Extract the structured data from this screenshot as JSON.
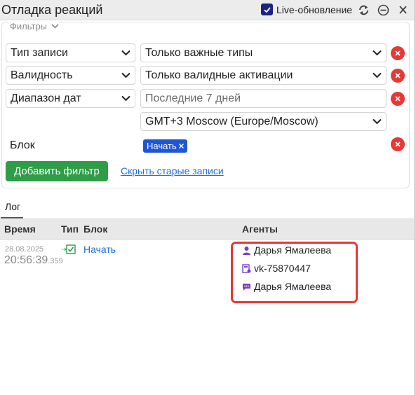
{
  "window": {
    "title": "Отладка реакций"
  },
  "toolbar": {
    "live_label": "Live-обновление",
    "live_checked": true,
    "icons": [
      "refresh-icon",
      "minus-circle-icon",
      "close-icon"
    ]
  },
  "filters": {
    "legend": "Фильтры",
    "rows": [
      {
        "field": "Тип записи",
        "value": "Только важные типы"
      },
      {
        "field": "Валидность",
        "value": "Только валидные активации"
      },
      {
        "field": "Диапазон дат",
        "value": "Последние 7 дней"
      }
    ],
    "timezone": "GMT+3 Moscow (Europe/Moscow)",
    "block_label": "Блок",
    "block_tag": "Начать",
    "add_button": "Добавить фильтр",
    "hide_link": "Скрыть старые записи"
  },
  "tabs": [
    "Лог"
  ],
  "table": {
    "columns": [
      "Время",
      "Тип",
      "Блок",
      "Агенты"
    ],
    "row": {
      "date": "28.08.2025",
      "time": "20:56:39",
      "ms": ".359",
      "block": "Начать",
      "agents": [
        {
          "icon": "user-icon",
          "name": "Дарья Ямалеева"
        },
        {
          "icon": "vk-page-icon",
          "name": "vk-75870447"
        },
        {
          "icon": "chat-bubble-icon",
          "name": "Дарья Ямалеева"
        }
      ]
    }
  },
  "colors": {
    "accent": "#1e56d6",
    "success": "#2e9d47",
    "danger": "#e53935",
    "link": "#1e6fd9",
    "agent_icon": "#7b3fc4"
  }
}
